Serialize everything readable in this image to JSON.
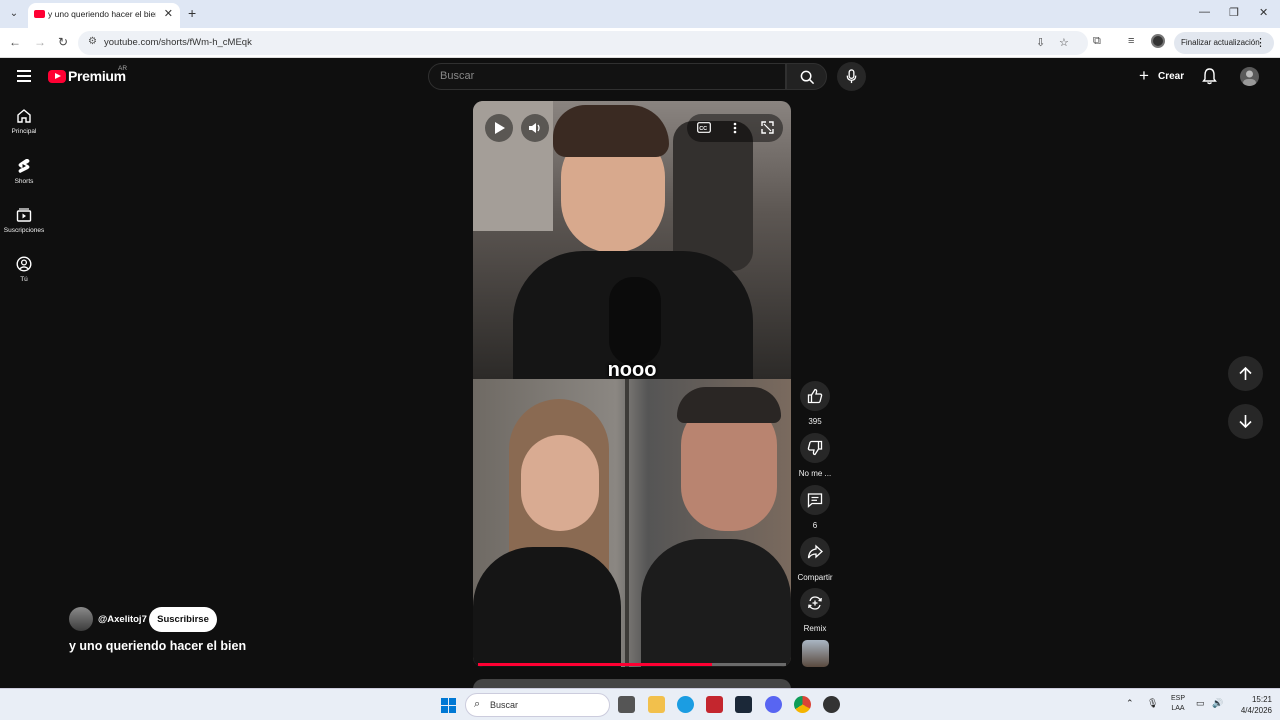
{
  "browser": {
    "tab_title": "y uno queriendo hacer el bien",
    "url": "youtube.com/shorts/fWm-h_cMEqk",
    "update_label": "Finalizar actualización"
  },
  "header": {
    "logo_text": "Premium",
    "country_code": "AR",
    "search_placeholder": "Buscar",
    "create_label": "Crear"
  },
  "sidebar": {
    "items": [
      {
        "label": "Principal",
        "icon": "home-icon"
      },
      {
        "label": "Shorts",
        "icon": "shorts-icon"
      },
      {
        "label": "Suscripciones",
        "icon": "subscriptions-icon"
      },
      {
        "label": "Tú",
        "icon": "you-icon"
      }
    ]
  },
  "video": {
    "caption": "nooo",
    "progress_fraction": 0.76
  },
  "actions": {
    "like_count": "395",
    "dislike_label": "No me ...",
    "comment_count": "6",
    "share_label": "Compartir",
    "remix_label": "Remix"
  },
  "channel": {
    "handle": "@Axelitoj7",
    "subscribe_label": "Suscribirse",
    "video_title": "y uno queriendo hacer el bien"
  },
  "taskbar": {
    "search_label": "Buscar",
    "lang_top": "ESP",
    "lang_bottom": "LAA",
    "time": "15:21",
    "date": "4/4/2026"
  },
  "colors": {
    "brand_red": "#ff0033",
    "background": "#0f0f0f",
    "button_bg": "#272727"
  }
}
